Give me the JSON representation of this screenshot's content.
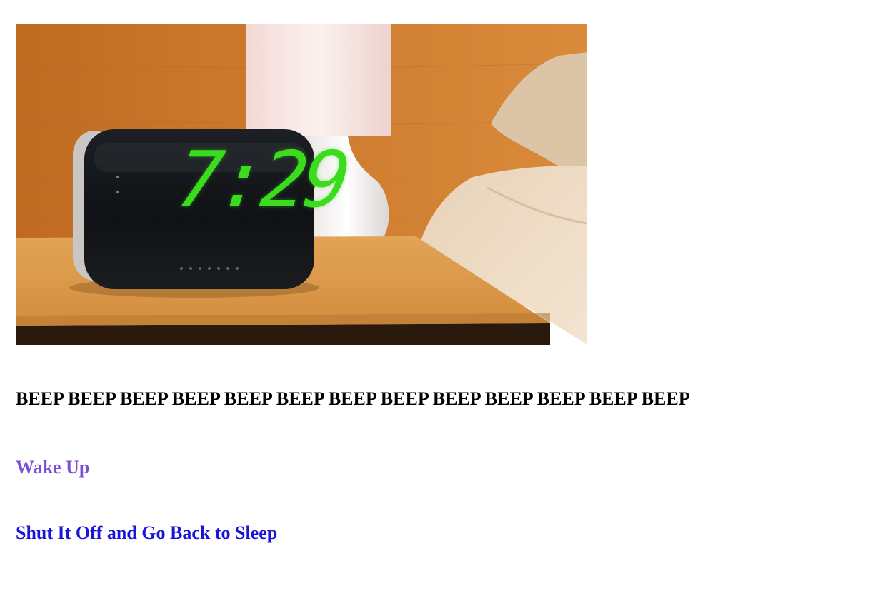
{
  "scene": {
    "clock_display": "7:29",
    "colors": {
      "wall": "#c9782e",
      "table": "#e0a04f",
      "clock_digits": "#3bdc1e",
      "lamp": "#f5e6e4"
    }
  },
  "headline": "BEEP BEEP BEEP BEEP BEEP BEEP BEEP BEEP BEEP BEEP BEEP BEEP BEEP",
  "choices": [
    {
      "label": "Wake Up",
      "state": "visited",
      "color": "#7a4fd6"
    },
    {
      "label": "Shut It Off and Go Back to Sleep",
      "state": "unvisited",
      "color": "#1a14d8"
    }
  ]
}
